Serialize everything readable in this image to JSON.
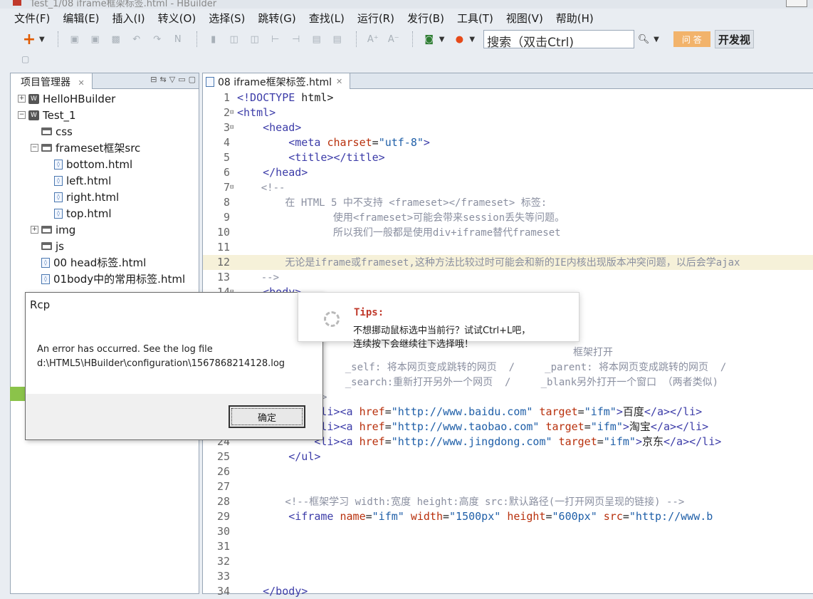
{
  "window": {
    "title": "Test_1/08 iframe框架标签.html - HBuilder"
  },
  "menu": [
    "文件(F)",
    "编辑(E)",
    "插入(I)",
    "转义(O)",
    "选择(S)",
    "跳转(G)",
    "查找(L)",
    "运行(R)",
    "发行(B)",
    "工具(T)",
    "视图(V)",
    "帮助(H)"
  ],
  "toolbar": {
    "search_text": "搜索（双击Ctrl)",
    "wenda": "问 答",
    "kaifa": "开发视"
  },
  "left_pane": {
    "tab_label": "项目管理器",
    "tree": [
      {
        "label": "HelloHBuilder",
        "indent": 0,
        "expander": "⊞",
        "icon": "project"
      },
      {
        "label": "Test_1",
        "indent": 0,
        "expander": "⊟",
        "icon": "project"
      },
      {
        "label": "css",
        "indent": 1,
        "expander": "",
        "icon": "folder"
      },
      {
        "label": "frameset框架src",
        "indent": 1,
        "expander": "⊟",
        "icon": "folder"
      },
      {
        "label": "bottom.html",
        "indent": 2,
        "expander": "",
        "icon": "file"
      },
      {
        "label": "left.html",
        "indent": 2,
        "expander": "",
        "icon": "file"
      },
      {
        "label": "right.html",
        "indent": 2,
        "expander": "",
        "icon": "file"
      },
      {
        "label": "top.html",
        "indent": 2,
        "expander": "",
        "icon": "file"
      },
      {
        "label": "img",
        "indent": 1,
        "expander": "⊞",
        "icon": "folder"
      },
      {
        "label": "js",
        "indent": 1,
        "expander": "",
        "icon": "folder"
      },
      {
        "label": "00 head标签.html",
        "indent": 1,
        "expander": "",
        "icon": "file"
      },
      {
        "label": "01body中的常用标签.html",
        "indent": 1,
        "expander": "",
        "icon": "file"
      }
    ]
  },
  "editor": {
    "tab_label": "08 iframe框架标签.html",
    "lines": [
      {
        "n": "1",
        "fold": "",
        "hl": false,
        "segs": [
          [
            "tag",
            "<!DOCTYPE"
          ],
          [
            "plain",
            " html>"
          ]
        ]
      },
      {
        "n": "2",
        "fold": "⊟",
        "hl": false,
        "segs": [
          [
            "tag",
            "<html>"
          ]
        ]
      },
      {
        "n": "3",
        "fold": "⊟",
        "hl": false,
        "segs": [
          [
            "plain",
            "    "
          ],
          [
            "tag",
            "<head>"
          ]
        ]
      },
      {
        "n": "4",
        "fold": "",
        "hl": false,
        "segs": [
          [
            "plain",
            "        "
          ],
          [
            "tag",
            "<meta "
          ],
          [
            "attr",
            "charset"
          ],
          [
            "plain",
            "="
          ],
          [
            "val",
            "\"utf-8\""
          ],
          [
            "tag",
            ">"
          ]
        ]
      },
      {
        "n": "5",
        "fold": "",
        "hl": false,
        "segs": [
          [
            "plain",
            "        "
          ],
          [
            "tag",
            "<title></title>"
          ]
        ]
      },
      {
        "n": "6",
        "fold": "",
        "hl": false,
        "segs": [
          [
            "plain",
            "    "
          ],
          [
            "tag",
            "</head>"
          ]
        ]
      },
      {
        "n": "7",
        "fold": "⊟",
        "hl": false,
        "segs": [
          [
            "cmt",
            "    <!--"
          ]
        ]
      },
      {
        "n": "8",
        "fold": "",
        "hl": false,
        "segs": [
          [
            "cmt",
            "        在 HTML 5 中不支持 <frameset></frameset> 标签:"
          ]
        ]
      },
      {
        "n": "9",
        "fold": "",
        "hl": false,
        "segs": [
          [
            "cmt",
            "                使用<frameset>可能会带来session丢失等问题。"
          ]
        ]
      },
      {
        "n": "10",
        "fold": "",
        "hl": false,
        "segs": [
          [
            "cmt",
            "                所以我们一般都是使用div+iframe替代frameset"
          ]
        ]
      },
      {
        "n": "11",
        "fold": "",
        "hl": false,
        "segs": []
      },
      {
        "n": "12",
        "fold": "",
        "hl": true,
        "segs": [
          [
            "cmt",
            "        无论是iframe或frameset,这种方法比较过时可能会和新的IE内核出现版本冲突问题，以后会学ajax"
          ]
        ]
      },
      {
        "n": "13",
        "fold": "",
        "hl": false,
        "segs": [
          [
            "cmt",
            "    -->"
          ]
        ]
      },
      {
        "n": "14",
        "fold": "⊟",
        "hl": false,
        "segs": [
          [
            "tag",
            "    <body>"
          ]
        ]
      },
      {
        "n": "15",
        "fold": "",
        "hl": false,
        "segs": []
      },
      {
        "n": "16",
        "fold": "",
        "hl": false,
        "segs": []
      },
      {
        "n": "17",
        "fold": "",
        "hl": false,
        "segs": []
      },
      {
        "n": "18",
        "fold": "",
        "hl": false,
        "segs": [
          [
            "cmt",
            "                                                        框架打开"
          ]
        ]
      },
      {
        "n": "19",
        "fold": "",
        "hl": false,
        "segs": [
          [
            "cmt",
            "                  _self: 将本网页变成跳转的网页  /     _parent: 将本网页变成跳转的网页  /"
          ]
        ]
      },
      {
        "n": "20",
        "fold": "",
        "hl": false,
        "segs": [
          [
            "cmt",
            "                  _search:重新打开另外一个网页  /     _blank另外打开一个窗口 （两者类似)"
          ]
        ]
      },
      {
        "n": "21",
        "fold": "",
        "hl": false,
        "segs": [
          [
            "cmt",
            "            -->"
          ]
        ]
      },
      {
        "n": "22",
        "fold": "",
        "hl": false,
        "segs": [
          [
            "plain",
            "            "
          ],
          [
            "tag",
            "<li><a "
          ],
          [
            "attr",
            "href"
          ],
          [
            "plain",
            "="
          ],
          [
            "val",
            "\"http://www.baidu.com\""
          ],
          [
            "plain",
            " "
          ],
          [
            "attr",
            "target"
          ],
          [
            "plain",
            "="
          ],
          [
            "val",
            "\"ifm\""
          ],
          [
            "tag",
            ">"
          ],
          [
            "plain",
            "百度"
          ],
          [
            "tag",
            "</a></li>"
          ]
        ]
      },
      {
        "n": "23",
        "fold": "",
        "hl": false,
        "segs": [
          [
            "plain",
            "            "
          ],
          [
            "tag",
            "<li><a "
          ],
          [
            "attr",
            "href"
          ],
          [
            "plain",
            "="
          ],
          [
            "val",
            "\"http://www.taobao.com\""
          ],
          [
            "plain",
            " "
          ],
          [
            "attr",
            "target"
          ],
          [
            "plain",
            "="
          ],
          [
            "val",
            "\"ifm\""
          ],
          [
            "tag",
            ">"
          ],
          [
            "plain",
            "淘宝"
          ],
          [
            "tag",
            "</a></li>"
          ]
        ]
      },
      {
        "n": "24",
        "fold": "",
        "hl": false,
        "segs": [
          [
            "plain",
            "            "
          ],
          [
            "tag",
            "<li><a "
          ],
          [
            "attr",
            "href"
          ],
          [
            "plain",
            "="
          ],
          [
            "val",
            "\"http://www.jingdong.com\""
          ],
          [
            "plain",
            " "
          ],
          [
            "attr",
            "target"
          ],
          [
            "plain",
            "="
          ],
          [
            "val",
            "\"ifm\""
          ],
          [
            "tag",
            ">"
          ],
          [
            "plain",
            "京东"
          ],
          [
            "tag",
            "</a></li>"
          ]
        ]
      },
      {
        "n": "25",
        "fold": "",
        "hl": false,
        "segs": [
          [
            "plain",
            "        "
          ],
          [
            "tag",
            "</ul>"
          ]
        ]
      },
      {
        "n": "26",
        "fold": "",
        "hl": false,
        "segs": []
      },
      {
        "n": "27",
        "fold": "",
        "hl": false,
        "segs": []
      },
      {
        "n": "28",
        "fold": "",
        "hl": false,
        "segs": [
          [
            "cmt",
            "        <!--框架学习 width:宽度 height:高度 src:默认路径(一打开网页呈现的链接) -->"
          ]
        ]
      },
      {
        "n": "29",
        "fold": "",
        "hl": false,
        "segs": [
          [
            "plain",
            "        "
          ],
          [
            "tag",
            "<iframe "
          ],
          [
            "attr",
            "name"
          ],
          [
            "plain",
            "="
          ],
          [
            "val",
            "\"ifm\""
          ],
          [
            "plain",
            " "
          ],
          [
            "attr",
            "width"
          ],
          [
            "plain",
            "="
          ],
          [
            "val",
            "\"1500px\""
          ],
          [
            "plain",
            " "
          ],
          [
            "attr",
            "height"
          ],
          [
            "plain",
            "="
          ],
          [
            "val",
            "\"600px\""
          ],
          [
            "plain",
            " "
          ],
          [
            "attr",
            "src"
          ],
          [
            "plain",
            "="
          ],
          [
            "val",
            "\"http://www.b"
          ]
        ]
      },
      {
        "n": "30",
        "fold": "",
        "hl": false,
        "segs": []
      },
      {
        "n": "31",
        "fold": "",
        "hl": false,
        "segs": []
      },
      {
        "n": "32",
        "fold": "",
        "hl": false,
        "segs": []
      },
      {
        "n": "33",
        "fold": "",
        "hl": false,
        "segs": []
      },
      {
        "n": "34",
        "fold": "",
        "hl": false,
        "segs": [
          [
            "tag",
            "    </body>"
          ]
        ]
      }
    ]
  },
  "rcp_dialog": {
    "title": "Rcp",
    "message_line1": "An error has occurred.  See the log file",
    "message_line2": "d:\\HTML5\\HBuilder\\configuration\\1567868214128.log",
    "ok_label": "确定"
  },
  "tips": {
    "heading": "Tips:",
    "line1": "不想挪动鼠标选中当前行？试试Ctrl+L吧，",
    "line2": "连续按下会继续往下选择哦！"
  }
}
